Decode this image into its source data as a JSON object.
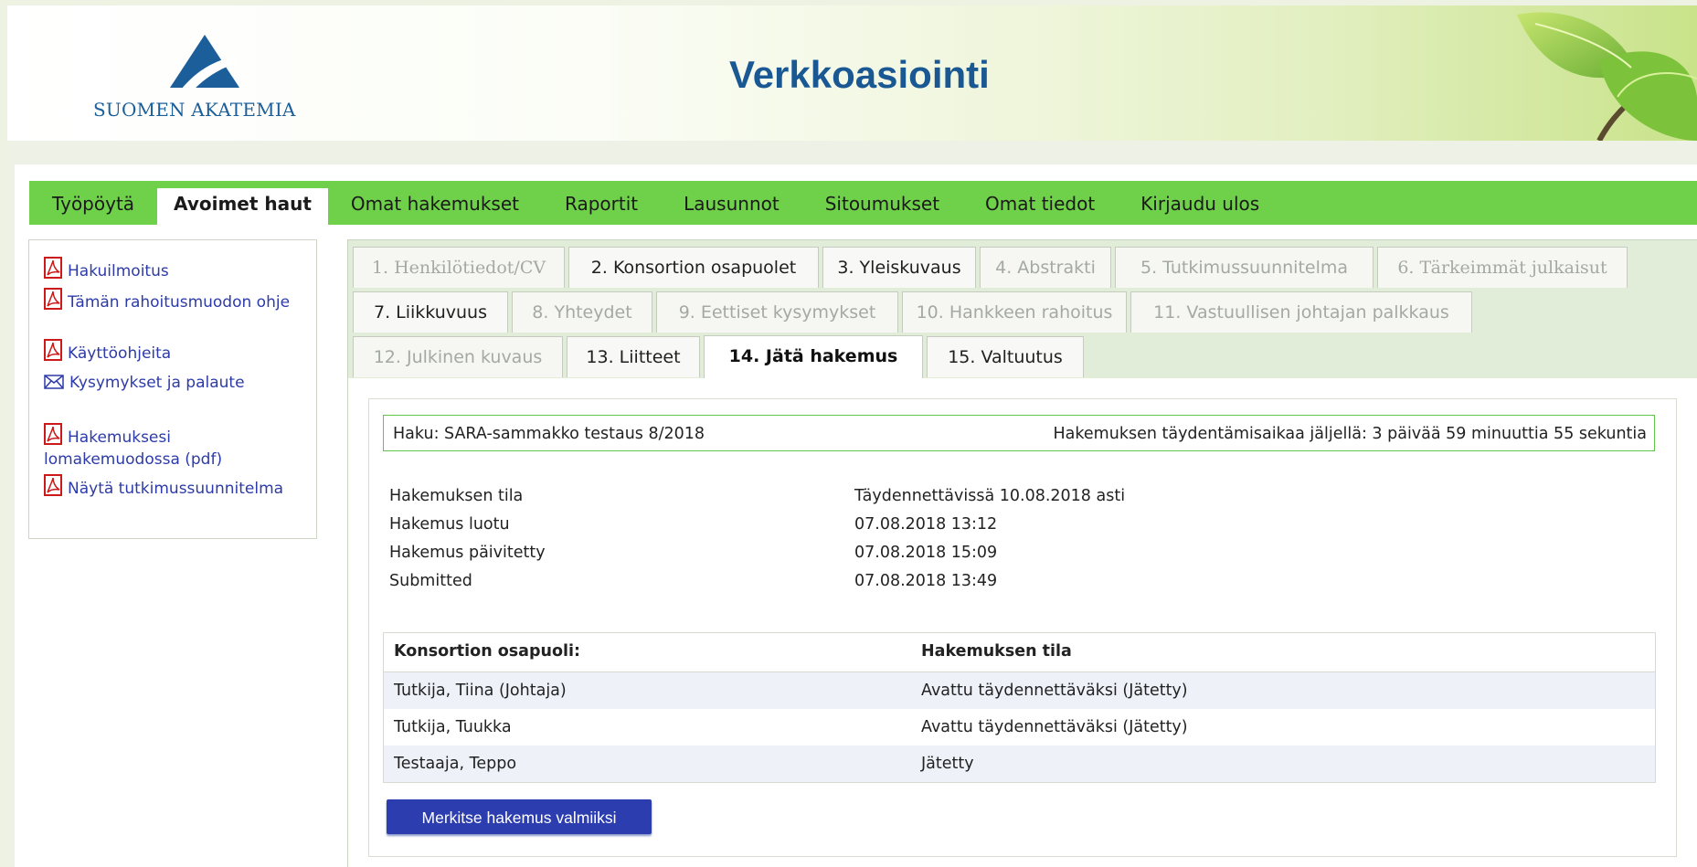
{
  "header": {
    "logo_text": "SUOMEN AKATEMIA",
    "title": "Verkkoasiointi"
  },
  "nav": {
    "items": [
      {
        "label": "Työpöytä"
      },
      {
        "label": "Avoimet haut",
        "active": true
      },
      {
        "label": "Omat hakemukset"
      },
      {
        "label": "Raportit"
      },
      {
        "label": "Lausunnot"
      },
      {
        "label": "Sitoumukset"
      },
      {
        "label": "Omat tiedot"
      },
      {
        "label": "Kirjaudu ulos"
      }
    ]
  },
  "sidebar": {
    "links": [
      {
        "label": "Hakuilmoitus",
        "icon": "pdf-icon"
      },
      {
        "label": "Tämän rahoitusmuodon ohje",
        "icon": "pdf-icon"
      },
      {
        "label": "Käyttöohjeita",
        "icon": "pdf-icon"
      },
      {
        "label": "Kysymykset ja palaute",
        "icon": "mail-icon"
      },
      {
        "label": "Hakemuksesi lomakemuodossa (pdf)",
        "icon": "pdf-icon"
      },
      {
        "label": "Näytä tutkimussuunnitelma",
        "icon": "pdf-icon"
      }
    ]
  },
  "tabs": [
    {
      "label": "1. Henkilötiedot/CV",
      "state": "disabled"
    },
    {
      "label": "2. Konsortion osapuolet",
      "state": "enabled"
    },
    {
      "label": "3. Yleiskuvaus",
      "state": "enabled"
    },
    {
      "label": "4. Abstrakti",
      "state": "disabled"
    },
    {
      "label": "5. Tutkimussuunnitelma",
      "state": "disabled"
    },
    {
      "label": "6. Tärkeimmät julkaisut",
      "state": "disabled"
    },
    {
      "label": "7. Liikkuvuus",
      "state": "enabled"
    },
    {
      "label": "8. Yhteydet",
      "state": "disabled"
    },
    {
      "label": "9. Eettiset kysymykset",
      "state": "disabled"
    },
    {
      "label": "10. Hankkeen rahoitus",
      "state": "disabled"
    },
    {
      "label": "11. Vastuullisen johtajan palkkaus",
      "state": "disabled"
    },
    {
      "label": "12. Julkinen kuvaus",
      "state": "disabled"
    },
    {
      "label": "13. Liitteet",
      "state": "enabled"
    },
    {
      "label": "14. Jätä hakemus",
      "state": "active"
    },
    {
      "label": "15. Valtuutus",
      "state": "enabled"
    }
  ],
  "haku": {
    "call": "Haku: SARA-sammakko testaus 8/2018",
    "time_left": "Hakemuksen täydentämisaikaa jäljellä: 3 päivää 59 minuuttia 55 sekuntia"
  },
  "info": [
    {
      "label": "Hakemuksen tila",
      "value": "Täydennettävissä 10.08.2018 asti"
    },
    {
      "label": "Hakemus luotu",
      "value": "07.08.2018 13:12"
    },
    {
      "label": "Hakemus päivitetty",
      "value": "07.08.2018 15:09"
    },
    {
      "label": "Submitted",
      "value": "07.08.2018 13:49"
    }
  ],
  "table": {
    "headers": [
      "Konsortion osapuoli:",
      "Hakemuksen tila"
    ],
    "rows": [
      [
        "Tutkija, Tiina (Johtaja)",
        "Avattu täydennettäväksi (Jätetty)"
      ],
      [
        "Tutkija, Tuukka",
        "Avattu täydennettäväksi (Jätetty)"
      ],
      [
        "Testaaja, Teppo",
        "Jätetty"
      ]
    ]
  },
  "button": {
    "label": "Merkitse hakemus valmiiksi"
  },
  "colors": {
    "nav_green": "#6fd14a",
    "link_blue": "#2d3ba8",
    "title_blue": "#1a5893",
    "button_blue": "#2c3db0",
    "box_border_green": "#5fc746"
  }
}
